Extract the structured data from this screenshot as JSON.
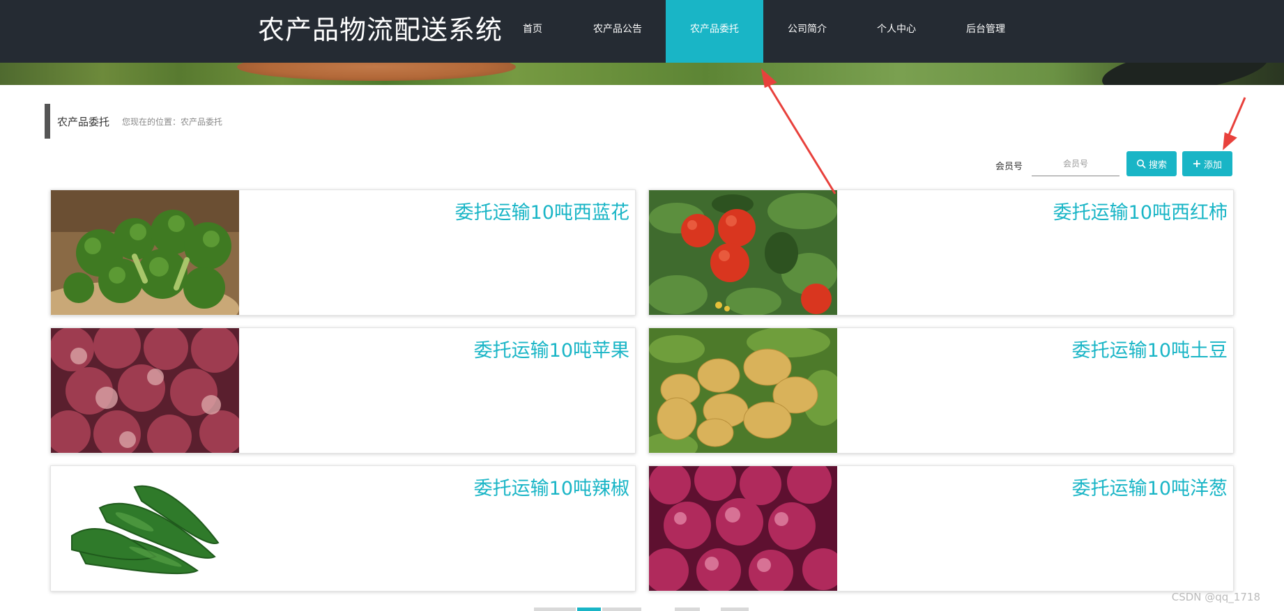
{
  "header": {
    "site_title": "农产品物流配送系统",
    "nav": [
      {
        "label": "首页"
      },
      {
        "label": "农产品公告"
      },
      {
        "label": "农产品委托",
        "active": true
      },
      {
        "label": "公司简介"
      },
      {
        "label": "个人中心"
      },
      {
        "label": "后台管理"
      }
    ],
    "bar_color": "#252b33",
    "accent_color": "#19b5c6"
  },
  "page": {
    "title": "农产品委托",
    "breadcrumb": "您现在的位置：农产品委托"
  },
  "search": {
    "label": "会员号",
    "placeholder": "会员号",
    "value": "",
    "search_button": "搜索",
    "search_icon": "search-icon",
    "add_button": "添加",
    "add_icon": "plus-icon"
  },
  "cards": [
    {
      "title": "委托运输10吨西蓝花",
      "image": "broccoli"
    },
    {
      "title": "委托运输10吨西红柿",
      "image": "tomato"
    },
    {
      "title": "委托运输10吨苹果",
      "image": "apple"
    },
    {
      "title": "委托运输10吨土豆",
      "image": "potato"
    },
    {
      "title": "委托运输10吨辣椒",
      "image": "green-pepper"
    },
    {
      "title": "委托运输10吨洋葱",
      "image": "red-onion"
    }
  ],
  "watermark": "CSDN @qq_1718"
}
